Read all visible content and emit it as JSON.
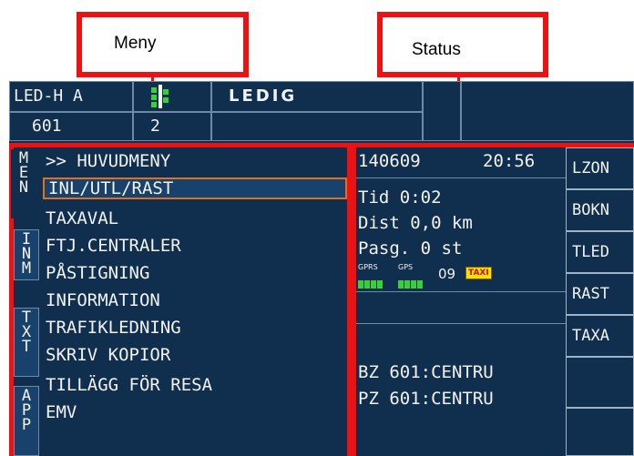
{
  "callouts": {
    "menu": "Meny",
    "status": "Status"
  },
  "header": {
    "driver_id": "LED-H A",
    "car_number": "601",
    "sub_value": "2",
    "state": "LEDIG"
  },
  "menu": {
    "side_tabs": [
      {
        "label": "MEN",
        "chars": [
          "M",
          "E",
          "N"
        ]
      },
      {
        "label": "INM",
        "chars": [
          "I",
          "N",
          "M"
        ]
      },
      {
        "label": "TXT",
        "chars": [
          "T",
          "X",
          "T"
        ]
      },
      {
        "label": "APP",
        "chars": [
          "A",
          "P",
          "P"
        ]
      }
    ],
    "items": [
      ">> HUVUDMENY",
      "INL/UTL/RAST",
      "TAXAVAL",
      "FTJ.CENTRALER",
      "PÅSTIGNING",
      "INFORMATION",
      "TRAFIKLEDNING",
      "SKRIV KOPIOR",
      "TILLÄGG FÖR RESA",
      "EMV"
    ],
    "selected_index": 1
  },
  "status": {
    "date": "140609",
    "time": "20:56",
    "tid": "Tid 0:02",
    "dist": "Dist 0,0 km",
    "pasg": "Pasg. 0 st",
    "gprs_label": "GPRS",
    "gps_label": "GPS",
    "count": "09",
    "taxi_badge": "TAXI",
    "bz": "BZ 601:CENTRU",
    "pz": "PZ 601:CENTRU"
  },
  "right_buttons": [
    "LZON",
    "BOKN",
    "TLED",
    "RAST",
    "TAXA",
    "",
    ""
  ],
  "colors": {
    "background": "#102f4f",
    "highlight": "#e07020",
    "signal": "#38d038",
    "taxi_badge": "#ffe000",
    "callout_border": "#ee1111"
  }
}
